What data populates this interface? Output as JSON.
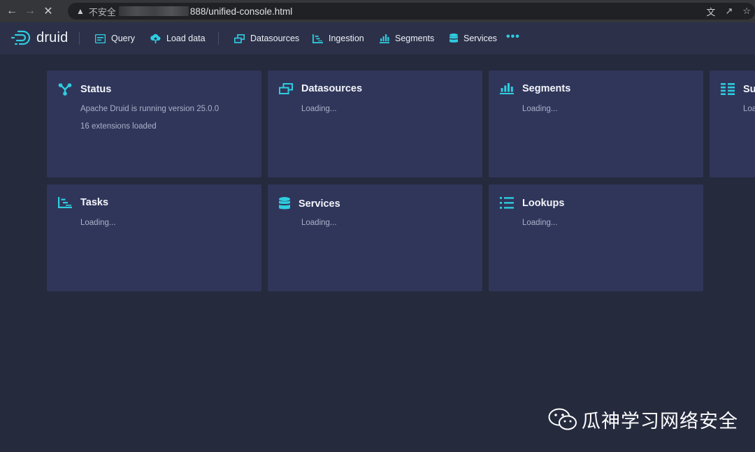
{
  "browser": {
    "security_label": "不安全",
    "url": "888/unified-console.html"
  },
  "nav": {
    "logo": "druid",
    "items": [
      {
        "label": "Query",
        "icon": "query-icon"
      },
      {
        "label": "Load data",
        "icon": "upload-icon"
      },
      {
        "label": "Datasources",
        "icon": "datasources-icon"
      },
      {
        "label": "Ingestion",
        "icon": "ingestion-icon"
      },
      {
        "label": "Segments",
        "icon": "segments-icon"
      },
      {
        "label": "Services",
        "icon": "database-icon"
      }
    ],
    "more": "•••"
  },
  "cards": {
    "status": {
      "title": "Status",
      "line1": "Apache Druid is running version 25.0.0",
      "line2": "16 extensions loaded"
    },
    "datasources": {
      "title": "Datasources",
      "line1": "Loading..."
    },
    "segments": {
      "title": "Segments",
      "line1": "Loading..."
    },
    "supervisors": {
      "title": "Su",
      "line1": "Loa"
    },
    "tasks": {
      "title": "Tasks",
      "line1": "Loading..."
    },
    "services": {
      "title": "Services",
      "line1": "Loading..."
    },
    "lookups": {
      "title": "Lookups",
      "line1": "Loading..."
    }
  },
  "watermark": {
    "text": "瓜神学习网络安全"
  },
  "colors": {
    "accent": "#2ecde0",
    "card": "#30365a",
    "nav": "#2c3149",
    "background": "#252a3d"
  }
}
